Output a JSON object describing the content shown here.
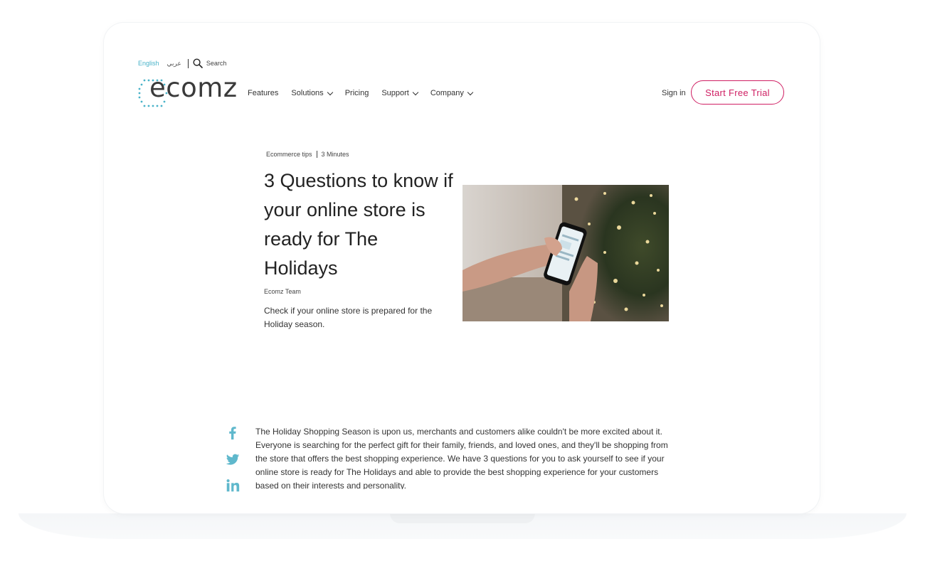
{
  "utility": {
    "lang_english": "English",
    "lang_arabic": "عربي",
    "search_label": "Search"
  },
  "brand": {
    "logo_text": "ecomz",
    "accent": "#4ab3c9",
    "cta_color": "#cf1f63"
  },
  "nav": {
    "items": [
      {
        "label": "Features",
        "has_dropdown": false
      },
      {
        "label": "Solutions",
        "has_dropdown": true
      },
      {
        "label": "Pricing",
        "has_dropdown": false
      },
      {
        "label": "Support",
        "has_dropdown": true
      },
      {
        "label": "Company",
        "has_dropdown": true
      }
    ],
    "signin": "Sign in",
    "cta": "Start Free Trial"
  },
  "article": {
    "category": "Ecommerce tips",
    "read_time": "3 Minutes",
    "title": "3 Questions to know if your online store is ready for The Holidays",
    "author": "Ecomz Team",
    "summary": "Check if your online store is prepared for the Holiday season.",
    "hero_image_icon": "phone-christmas-tree-photo",
    "body": "The Holiday Shopping Season is upon us, merchants and customers alike couldn't be more excited about it. Everyone is searching for the perfect gift for their family, friends, and loved ones, and they'll be shopping from the store that offers the best shopping experience. We have 3 questions for you to ask yourself to see if your online store is ready for The Holidays and able to provide the best shopping experience for your customers based on their interests and personality."
  },
  "share": {
    "icons": [
      "facebook-icon",
      "twitter-icon",
      "linkedin-icon"
    ],
    "color": "#5fb8cc"
  }
}
